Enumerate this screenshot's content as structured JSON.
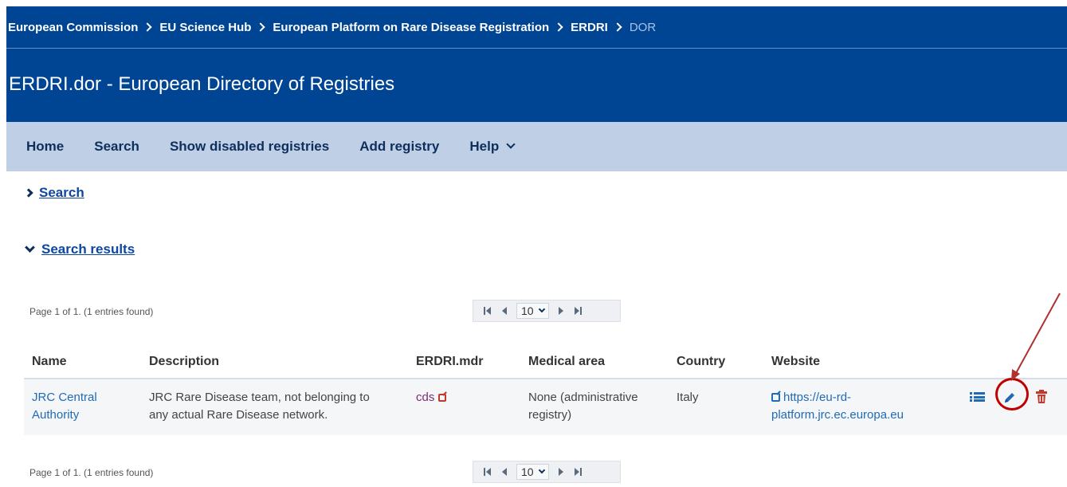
{
  "breadcrumb": [
    {
      "label": "European Commission"
    },
    {
      "label": "EU Science Hub"
    },
    {
      "label": "European Platform on Rare Disease Registration"
    },
    {
      "label": "ERDRI"
    },
    {
      "label": "DOR"
    }
  ],
  "site_title": "ERDRI.dor - European Directory of Registries",
  "menu": {
    "home": "Home",
    "search": "Search",
    "show_disabled": "Show disabled registries",
    "add_registry": "Add registry",
    "help": "Help"
  },
  "sections": {
    "search": "Search",
    "search_results": "Search results"
  },
  "pagination": {
    "info": "Page 1 of 1. (1 entries found)",
    "page_size": "10"
  },
  "table": {
    "headers": [
      "Name",
      "Description",
      "ERDRI.mdr",
      "Medical area",
      "Country",
      "Website"
    ],
    "rows": [
      {
        "name_line1": "JRC Central",
        "name_line2": "Authority",
        "description_line1": "JRC Rare Disease team, not belonging to",
        "description_line2": "any actual Rare Disease network.",
        "mdr": "cds",
        "medical_area_line1": "None (administrative",
        "medical_area_line2": "registry)",
        "country": "Italy",
        "website_line1": "https://eu-rd-",
        "website_line2": "platform.jrc.ec.europa.eu"
      }
    ]
  },
  "colors": {
    "banner": "#004494",
    "menubar": "#bfd0e6",
    "link": "#1f6bb8",
    "annotation": "#c00000",
    "delete": "#c0392b"
  },
  "icons": {
    "details": "list-icon",
    "edit": "pencil-icon",
    "delete": "trash-icon",
    "external": "external-link-icon"
  }
}
